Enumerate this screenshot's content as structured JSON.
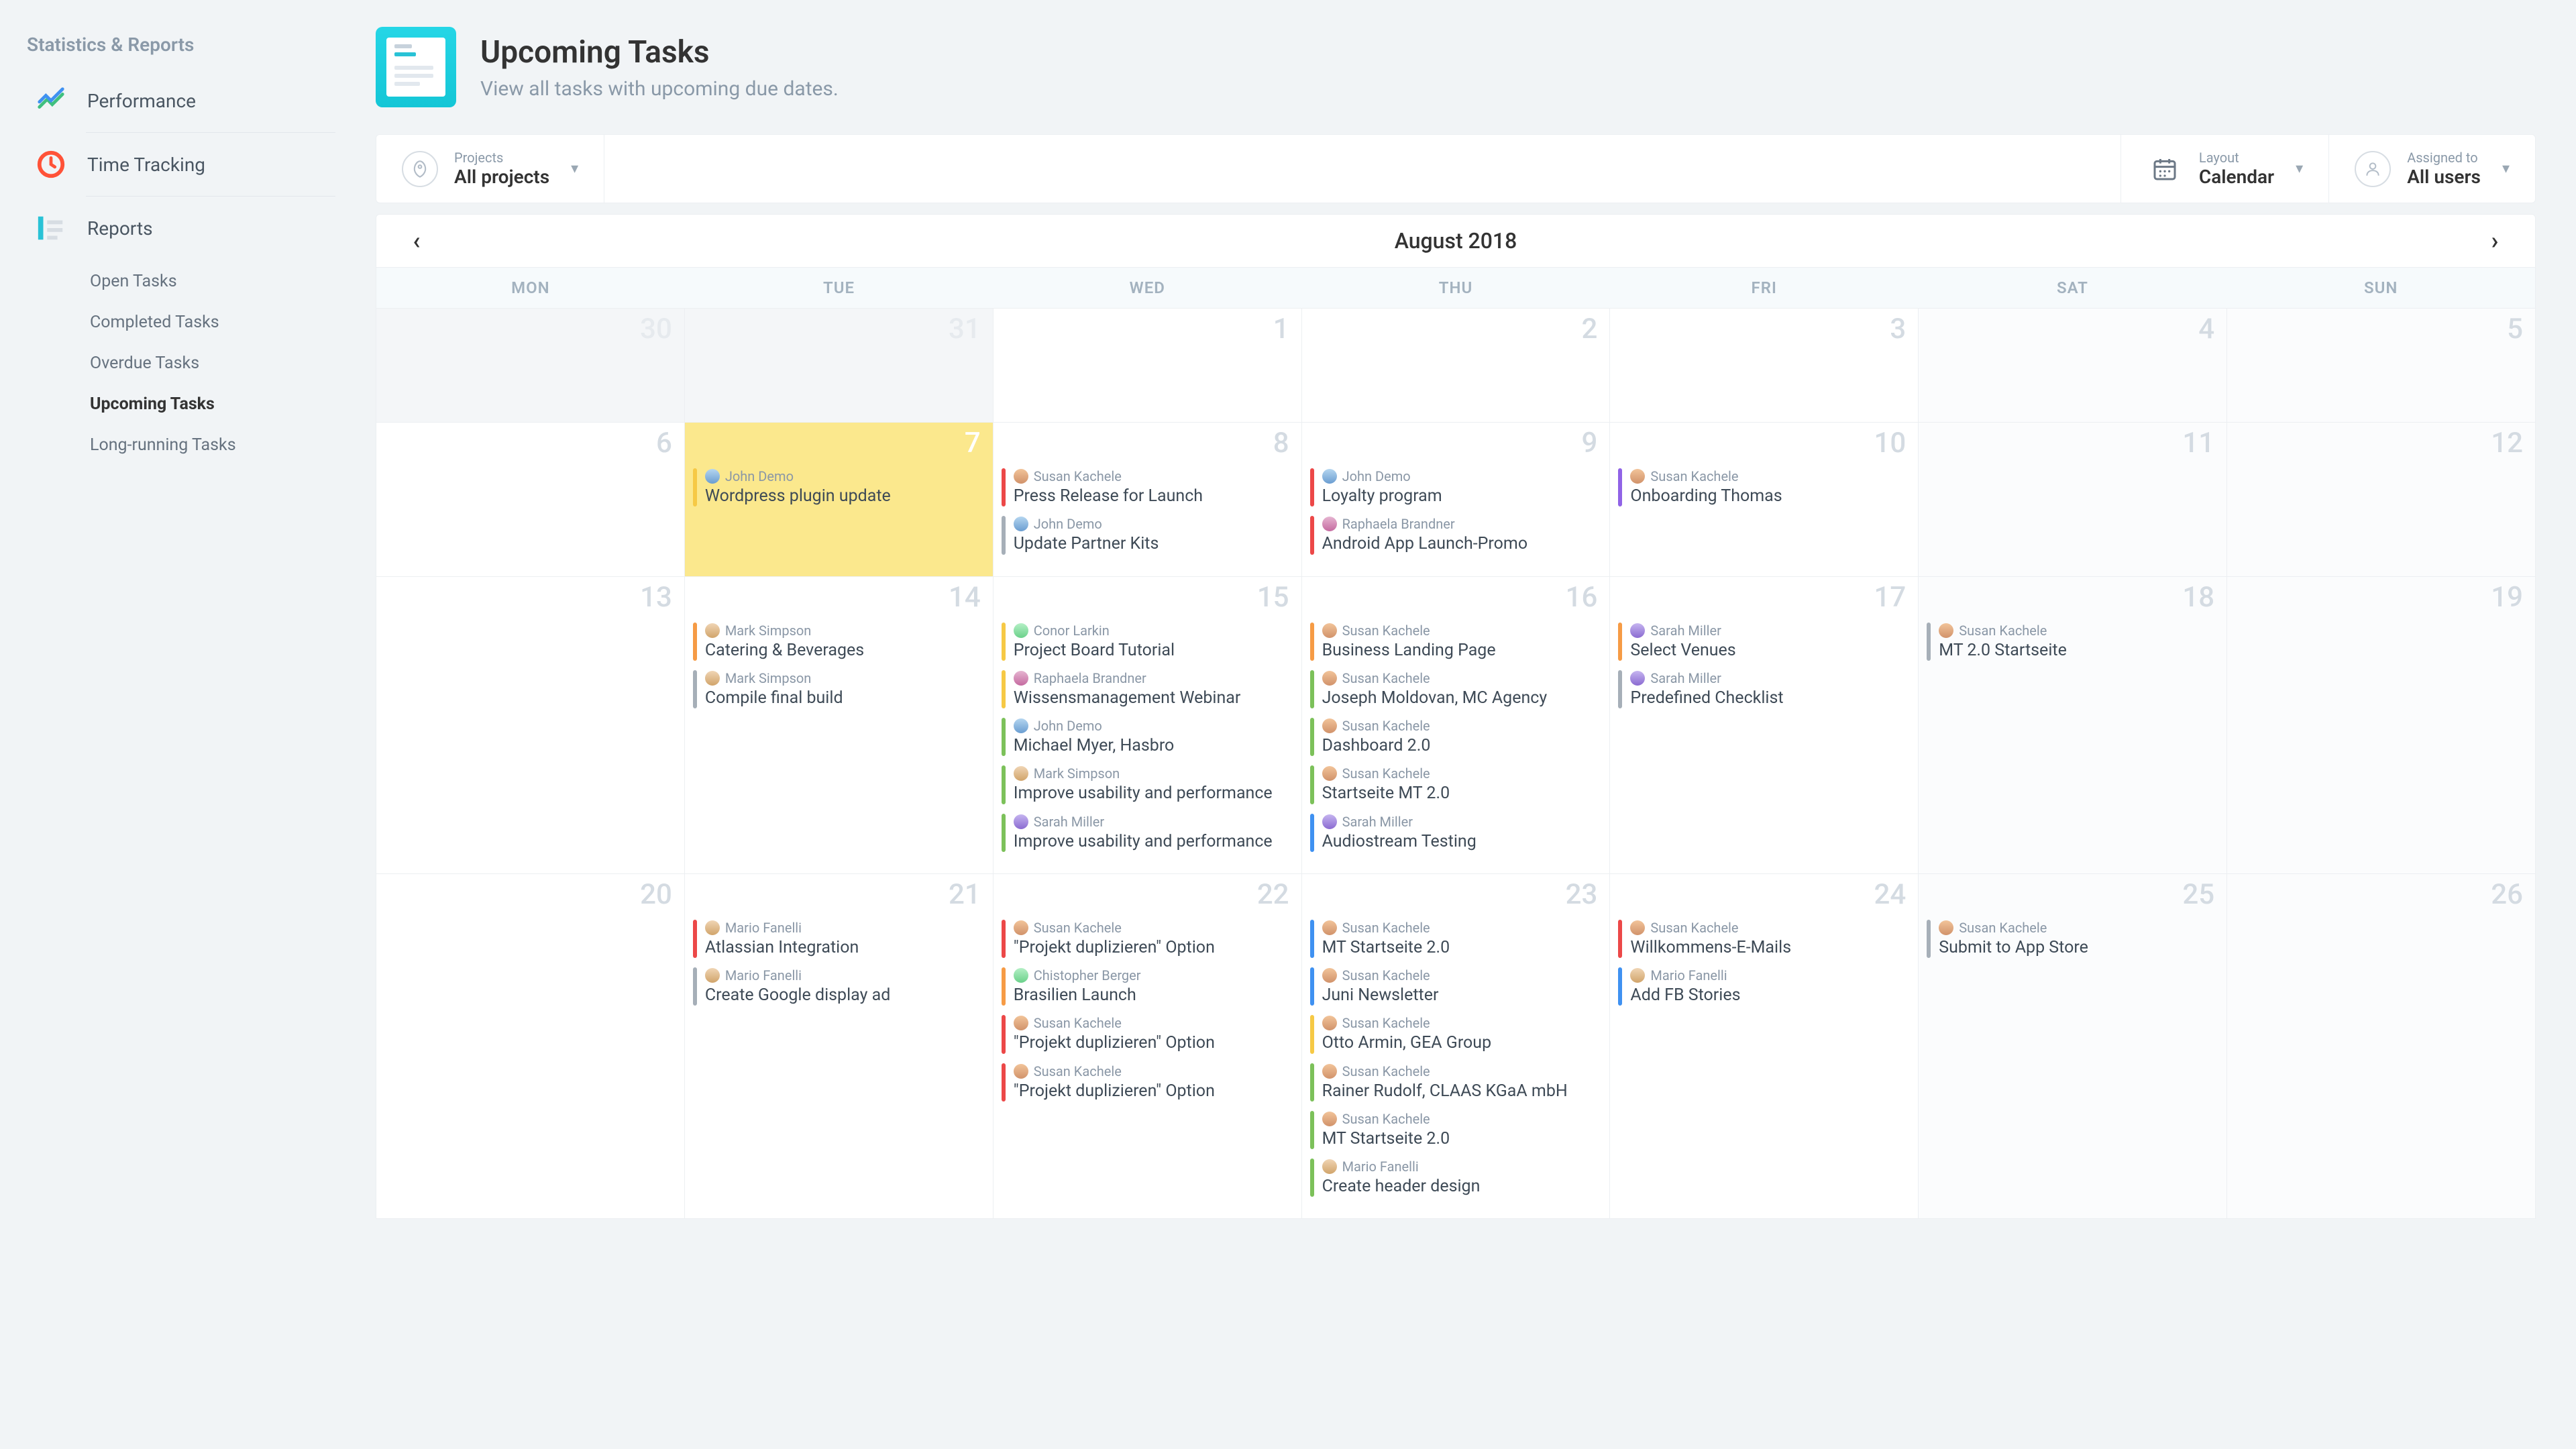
{
  "sidebar": {
    "section_title": "Statistics & Reports",
    "items": [
      {
        "label": "Performance"
      },
      {
        "label": "Time Tracking"
      },
      {
        "label": "Reports"
      }
    ],
    "sub_items": [
      {
        "label": "Open Tasks"
      },
      {
        "label": "Completed Tasks"
      },
      {
        "label": "Overdue Tasks"
      },
      {
        "label": "Upcoming Tasks",
        "active": true
      },
      {
        "label": "Long-running Tasks"
      }
    ]
  },
  "page": {
    "title": "Upcoming Tasks",
    "subtitle": "View all tasks with upcoming due dates."
  },
  "filters": {
    "projects": {
      "label": "Projects",
      "value": "All projects"
    },
    "layout": {
      "label": "Layout",
      "value": "Calendar"
    },
    "assigned": {
      "label": "Assigned to",
      "value": "All users"
    }
  },
  "calendar": {
    "month": "August 2018",
    "days": [
      "MON",
      "TUE",
      "WED",
      "THU",
      "FRI",
      "SAT",
      "SUN"
    ],
    "weeks": [
      [
        {
          "date": "30",
          "cls": "prev",
          "tasks": []
        },
        {
          "date": "31",
          "cls": "prev",
          "tasks": []
        },
        {
          "date": "1",
          "cls": "",
          "tasks": []
        },
        {
          "date": "2",
          "cls": "",
          "tasks": []
        },
        {
          "date": "3",
          "cls": "",
          "tasks": []
        },
        {
          "date": "4",
          "cls": "shaded",
          "tasks": []
        },
        {
          "date": "5",
          "cls": "shaded",
          "tasks": []
        }
      ],
      [
        {
          "date": "6",
          "cls": "",
          "tasks": []
        },
        {
          "date": "7",
          "cls": "today",
          "tasks": [
            {
              "color": "c-yellow",
              "user": "John Demo",
              "av": "av2",
              "title": "Wordpress plugin update"
            }
          ]
        },
        {
          "date": "8",
          "cls": "",
          "tasks": [
            {
              "color": "c-red",
              "user": "Susan Kachele",
              "av": "av1",
              "title": "Press Release for Launch"
            },
            {
              "color": "c-grey",
              "user": "John Demo",
              "av": "av2",
              "title": "Update Partner Kits"
            }
          ]
        },
        {
          "date": "9",
          "cls": "",
          "tasks": [
            {
              "color": "c-red",
              "user": "John Demo",
              "av": "av2",
              "title": "Loyalty program"
            },
            {
              "color": "c-red",
              "user": "Raphaela Brandner",
              "av": "av3",
              "title": "Android App Launch-Promo"
            }
          ]
        },
        {
          "date": "10",
          "cls": "",
          "tasks": [
            {
              "color": "c-purple",
              "user": "Susan Kachele",
              "av": "av1",
              "title": "Onboarding Thomas"
            }
          ]
        },
        {
          "date": "11",
          "cls": "shaded",
          "tasks": []
        },
        {
          "date": "12",
          "cls": "shaded",
          "tasks": []
        }
      ],
      [
        {
          "date": "13",
          "cls": "",
          "tasks": []
        },
        {
          "date": "14",
          "cls": "",
          "tasks": [
            {
              "color": "c-orange",
              "user": "Mark Simpson",
              "av": "av6",
              "title": "Catering & Beverages"
            },
            {
              "color": "c-grey",
              "user": "Mark Simpson",
              "av": "av6",
              "title": "Compile final build"
            }
          ]
        },
        {
          "date": "15",
          "cls": "",
          "tasks": [
            {
              "color": "c-yellow",
              "user": "Conor Larkin",
              "av": "av5",
              "title": "Project Board Tutorial"
            },
            {
              "color": "c-yellow",
              "user": "Raphaela Brandner",
              "av": "av3",
              "title": "Wissensmanagement Webinar"
            },
            {
              "color": "c-green",
              "user": "John Demo",
              "av": "av2",
              "title": "Michael Myer, Hasbro"
            },
            {
              "color": "c-green",
              "user": "Mark Simpson",
              "av": "av6",
              "title": "Improve usability and performance"
            },
            {
              "color": "c-green",
              "user": "Sarah Miller",
              "av": "av4",
              "title": "Improve usability and performance"
            }
          ]
        },
        {
          "date": "16",
          "cls": "",
          "tasks": [
            {
              "color": "c-orange",
              "user": "Susan Kachele",
              "av": "av1",
              "title": "Business Landing Page"
            },
            {
              "color": "c-green",
              "user": "Susan Kachele",
              "av": "av1",
              "title": "Joseph Moldovan, MC Agency"
            },
            {
              "color": "c-green",
              "user": "Susan Kachele",
              "av": "av1",
              "title": "Dashboard 2.0"
            },
            {
              "color": "c-green",
              "user": "Susan Kachele",
              "av": "av1",
              "title": "Startseite MT 2.0"
            },
            {
              "color": "c-blue",
              "user": "Sarah Miller",
              "av": "av4",
              "title": "Audiostream Testing"
            }
          ]
        },
        {
          "date": "17",
          "cls": "",
          "tasks": [
            {
              "color": "c-orange",
              "user": "Sarah Miller",
              "av": "av4",
              "title": "Select Venues"
            },
            {
              "color": "c-grey",
              "user": "Sarah Miller",
              "av": "av4",
              "title": "Predefined Checklist"
            }
          ]
        },
        {
          "date": "18",
          "cls": "shaded",
          "tasks": [
            {
              "color": "c-grey",
              "user": "Susan Kachele",
              "av": "av1",
              "title": "MT 2.0 Startseite"
            }
          ]
        },
        {
          "date": "19",
          "cls": "shaded",
          "tasks": []
        }
      ],
      [
        {
          "date": "20",
          "cls": "",
          "tasks": []
        },
        {
          "date": "21",
          "cls": "",
          "tasks": [
            {
              "color": "c-red",
              "user": "Mario Fanelli",
              "av": "av6",
              "title": "Atlassian Integration"
            },
            {
              "color": "c-grey",
              "user": "Mario Fanelli",
              "av": "av6",
              "title": "Create Google display ad"
            }
          ]
        },
        {
          "date": "22",
          "cls": "",
          "tasks": [
            {
              "color": "c-red",
              "user": "Susan Kachele",
              "av": "av1",
              "title": "\"Projekt duplizieren\" Option"
            },
            {
              "color": "c-orange",
              "user": "Chistopher Berger",
              "av": "av5",
              "title": "Brasilien Launch"
            },
            {
              "color": "c-red",
              "user": "Susan Kachele",
              "av": "av1",
              "title": "\"Projekt duplizieren\" Option"
            },
            {
              "color": "c-red",
              "user": "Susan Kachele",
              "av": "av1",
              "title": "\"Projekt duplizieren\" Option"
            }
          ]
        },
        {
          "date": "23",
          "cls": "",
          "tasks": [
            {
              "color": "c-blue",
              "user": "Susan Kachele",
              "av": "av1",
              "title": "MT Startseite 2.0"
            },
            {
              "color": "c-blue",
              "user": "Susan Kachele",
              "av": "av1",
              "title": "Juni Newsletter"
            },
            {
              "color": "c-yellow",
              "user": "Susan Kachele",
              "av": "av1",
              "title": "Otto Armin, GEA Group"
            },
            {
              "color": "c-green",
              "user": "Susan Kachele",
              "av": "av1",
              "title": "Rainer Rudolf, CLAAS KGaA mbH"
            },
            {
              "color": "c-green",
              "user": "Susan Kachele",
              "av": "av1",
              "title": "MT Startseite 2.0"
            },
            {
              "color": "c-green",
              "user": "Mario Fanelli",
              "av": "av6",
              "title": "Create header design"
            }
          ]
        },
        {
          "date": "24",
          "cls": "",
          "tasks": [
            {
              "color": "c-red",
              "user": "Susan Kachele",
              "av": "av1",
              "title": "Willkommens-E-Mails"
            },
            {
              "color": "c-blue",
              "user": "Mario Fanelli",
              "av": "av6",
              "title": "Add FB Stories"
            }
          ]
        },
        {
          "date": "25",
          "cls": "shaded",
          "tasks": [
            {
              "color": "c-grey",
              "user": "Susan Kachele",
              "av": "av1",
              "title": "Submit to App Store"
            }
          ]
        },
        {
          "date": "26",
          "cls": "shaded",
          "tasks": []
        }
      ]
    ]
  }
}
